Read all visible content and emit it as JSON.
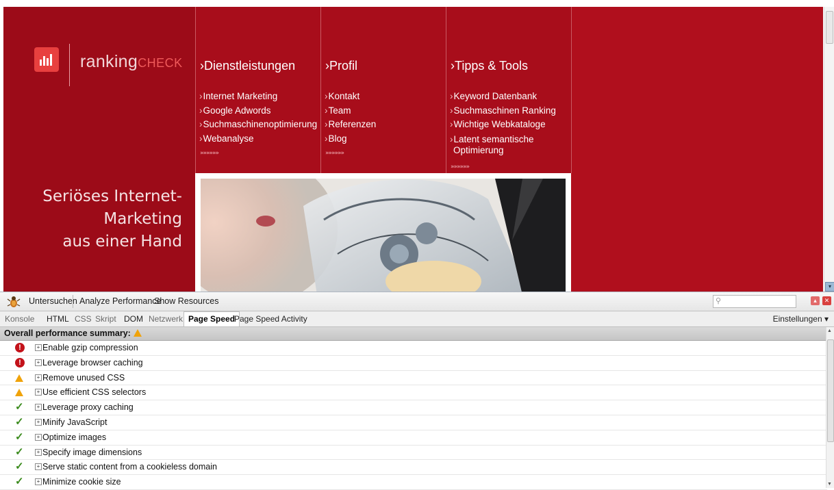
{
  "site": {
    "logo": {
      "text_main": "ranking",
      "text_accent": "CHECK"
    },
    "tagline": [
      "Seriöses Internet-",
      "Marketing",
      "aus einer Hand"
    ],
    "menu": [
      {
        "heading": "Dienstleistungen",
        "items": [
          "Internet Marketing",
          "Google Adwords",
          "Suchmaschinenoptimierung",
          "Webanalyse"
        ],
        "more": "»»»»»»"
      },
      {
        "heading": "Profil",
        "items": [
          "Kontakt",
          "Team",
          "Referenzen",
          "Blog"
        ],
        "more": "»»»»»»"
      },
      {
        "heading": "Tipps & Tools",
        "items": [
          "Keyword Datenbank",
          "Suchmaschinen Ranking",
          "Wichtige Webkataloge",
          "Latent semantische",
          "Optimierung"
        ],
        "more": "»»»»»»"
      }
    ],
    "colors": {
      "brand_red": "#a80d1b",
      "logo_red": "#e8403f"
    }
  },
  "firebug": {
    "toolbar": {
      "inspect": "Untersuchen",
      "analyze": "Analyze Performance",
      "resources": "Show Resources"
    },
    "tabs": [
      "Konsole",
      "HTML",
      "CSS",
      "Skript",
      "DOM",
      "Netzwerk",
      "Page Speed",
      "Page Speed Activity"
    ],
    "active_tab": "Page Speed",
    "settings_label": "Einstellungen ▾",
    "summary": "Overall performance summary:",
    "rules": [
      {
        "label": "Enable gzip compression",
        "status": "error"
      },
      {
        "label": "Leverage browser caching",
        "status": "error"
      },
      {
        "label": "Remove unused CSS",
        "status": "warning"
      },
      {
        "label": "Use efficient CSS selectors",
        "status": "warning"
      },
      {
        "label": "Leverage proxy caching",
        "status": "ok"
      },
      {
        "label": "Minify JavaScript",
        "status": "ok"
      },
      {
        "label": "Optimize images",
        "status": "ok"
      },
      {
        "label": "Specify image dimensions",
        "status": "ok"
      },
      {
        "label": "Serve static content from a cookieless domain",
        "status": "ok"
      },
      {
        "label": "Minimize cookie size",
        "status": "ok"
      }
    ]
  }
}
